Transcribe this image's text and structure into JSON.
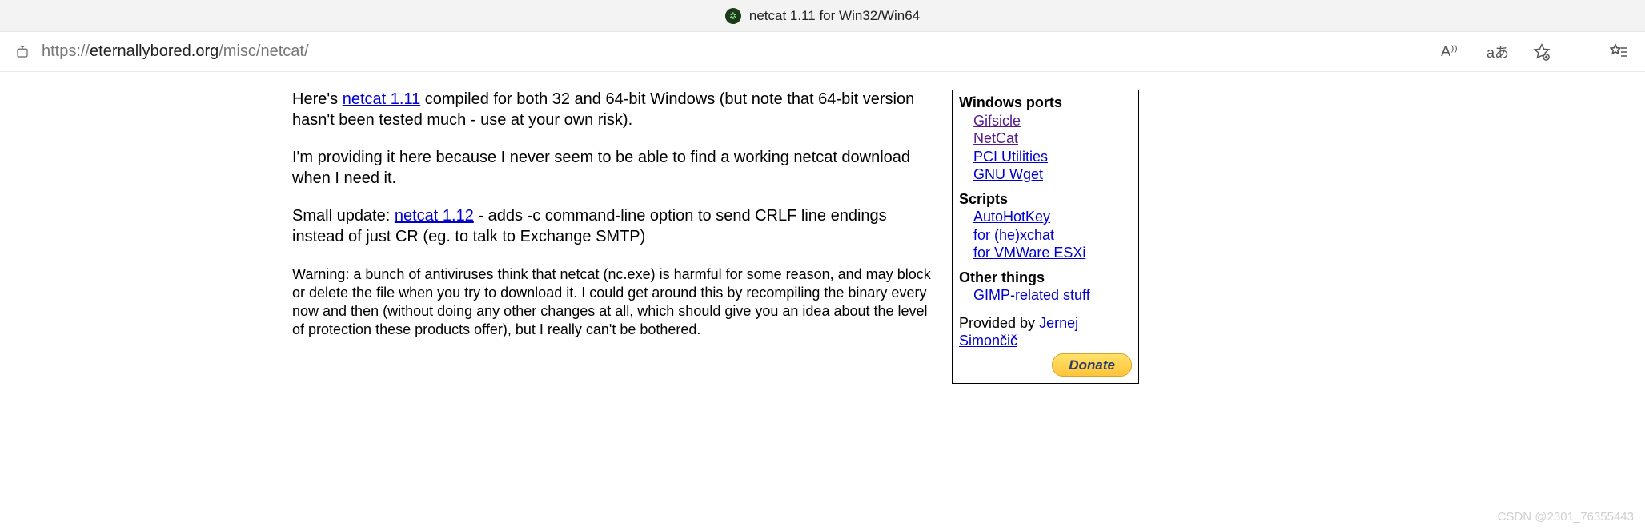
{
  "tab": {
    "title": "netcat 1.11 for Win32/Win64"
  },
  "url": {
    "proto": "https://",
    "host": "eternallybored.org",
    "path": "/misc/netcat/"
  },
  "toolbar": {
    "read_aloud": "A⁾⁾",
    "translate": "aあ"
  },
  "main": {
    "p1_a": "Here's ",
    "p1_link": "netcat 1.11",
    "p1_b": " compiled for both 32 and 64-bit Windows (but note that 64-bit version hasn't been tested much - use at your own risk).",
    "p2": "I'm providing it here because I never seem to be able to find a working netcat download when I need it.",
    "p3_a": "Small update: ",
    "p3_link": "netcat 1.12",
    "p3_b": " - adds -c command-line option to send CRLF line endings instead of just CR (eg. to talk to Exchange SMTP)",
    "p4": "Warning: a bunch of antiviruses think that netcat (nc.exe) is harmful for some reason, and may block or delete the file when you try to download it. I could get around this by recompiling the binary every now and then (without doing any other changes at all, which should give you an idea about the level of protection these products offer), but I really can't be bothered."
  },
  "sidebar": {
    "sec1_title": "Windows ports",
    "sec1_items": [
      "Gifsicle",
      "NetCat",
      "PCI Utilities",
      "GNU Wget"
    ],
    "sec2_title": "Scripts",
    "sec2_items": [
      "AutoHotKey",
      "for (he)xchat",
      "for VMWare ESXi"
    ],
    "sec3_title": "Other things",
    "sec3_items": [
      "GIMP-related stuff"
    ],
    "provided_a": "Provided by ",
    "provided_link": "Jernej Simončič",
    "donate": "Donate"
  },
  "watermark": "CSDN @2301_76355443"
}
